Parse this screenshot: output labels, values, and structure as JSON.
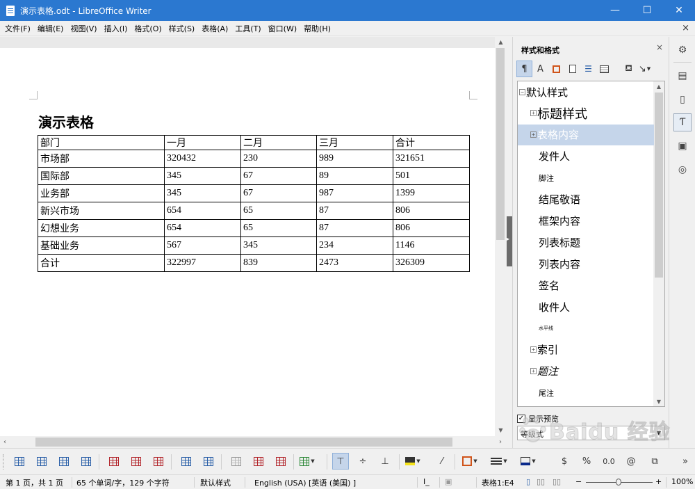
{
  "window": {
    "title": "演示表格.odt - LibreOffice Writer",
    "min_label": "—",
    "max_label": "☐",
    "close_label": "✕"
  },
  "menu": [
    "文件(F)",
    "编辑(E)",
    "视图(V)",
    "插入(I)",
    "格式(O)",
    "样式(S)",
    "表格(A)",
    "工具(T)",
    "窗口(W)",
    "帮助(H)"
  ],
  "menu_close": "×",
  "document": {
    "heading": "演示表格",
    "table": {
      "header": [
        "部门",
        "一月",
        "二月",
        "三月",
        "合计"
      ],
      "rows": [
        [
          "市场部",
          "320432",
          "230",
          "989",
          "321651"
        ],
        [
          "国际部",
          "345",
          "67",
          "89",
          "501"
        ],
        [
          "业务部",
          "345",
          "67",
          "987",
          "1399"
        ],
        [
          "新兴市场",
          "654",
          "65",
          "87",
          "806"
        ],
        [
          "幻想业务",
          "654",
          "65",
          "87",
          "806"
        ],
        [
          "基础业务",
          "567",
          "345",
          "234",
          "1146"
        ],
        [
          "合计",
          "322997",
          "839",
          "2473",
          "326309"
        ]
      ]
    }
  },
  "sidebar": {
    "title": "样式和格式",
    "close": "×",
    "tools": {
      "paragraph": "¶",
      "character": "A",
      "new_style": "↘"
    },
    "styles": [
      {
        "label": "默认样式",
        "expander": "⊟",
        "indent": 0,
        "size": 15,
        "sel": false,
        "italic": false
      },
      {
        "label": "标题样式",
        "expander": "⊞",
        "indent": 1,
        "size": 18,
        "sel": false,
        "italic": false
      },
      {
        "label": "表格内容",
        "expander": "⊞",
        "indent": 1,
        "size": 15,
        "sel": true,
        "italic": false
      },
      {
        "label": "发件人",
        "expander": "",
        "indent": 2,
        "size": 15,
        "sel": false,
        "italic": false
      },
      {
        "label": "脚注",
        "expander": "",
        "indent": 2,
        "size": 11,
        "sel": false,
        "italic": false
      },
      {
        "label": "结尾敬语",
        "expander": "",
        "indent": 2,
        "size": 15,
        "sel": false,
        "italic": false
      },
      {
        "label": "框架内容",
        "expander": "",
        "indent": 2,
        "size": 15,
        "sel": false,
        "italic": false
      },
      {
        "label": "列表标题",
        "expander": "",
        "indent": 2,
        "size": 15,
        "sel": false,
        "italic": false
      },
      {
        "label": "列表内容",
        "expander": "",
        "indent": 2,
        "size": 15,
        "sel": false,
        "italic": false
      },
      {
        "label": "签名",
        "expander": "",
        "indent": 2,
        "size": 15,
        "sel": false,
        "italic": false
      },
      {
        "label": "收件人",
        "expander": "",
        "indent": 2,
        "size": 15,
        "sel": false,
        "italic": false
      },
      {
        "label": "水平线",
        "expander": "",
        "indent": 2,
        "size": 7,
        "sel": false,
        "italic": false
      },
      {
        "label": "索引",
        "expander": "⊞",
        "indent": 1,
        "size": 15,
        "sel": false,
        "italic": false
      },
      {
        "label": "题注",
        "expander": "⊞",
        "indent": 1,
        "size": 15,
        "sel": false,
        "italic": true
      },
      {
        "label": "尾注",
        "expander": "",
        "indent": 2,
        "size": 11,
        "sel": false,
        "italic": false
      }
    ],
    "show_preview_label": "显示预览",
    "show_preview_checked": "✓",
    "filter_value": "等级式"
  },
  "table_toolbar": {
    "currency": "$",
    "percent": "%",
    "decimal": "0.0",
    "at": "@"
  },
  "statusbar": {
    "page": "第 1 页，共 1 页",
    "words": "65 个单词/字，129 个字符",
    "page_style": "默认样式",
    "language": "English (USA) [英语 (美国) ]",
    "cursor": "I_",
    "table_cell": "表格1:E4",
    "zoom_minus": "−",
    "zoom_plus": "+",
    "zoom": "100%"
  },
  "watermark": "Baidu 经验"
}
